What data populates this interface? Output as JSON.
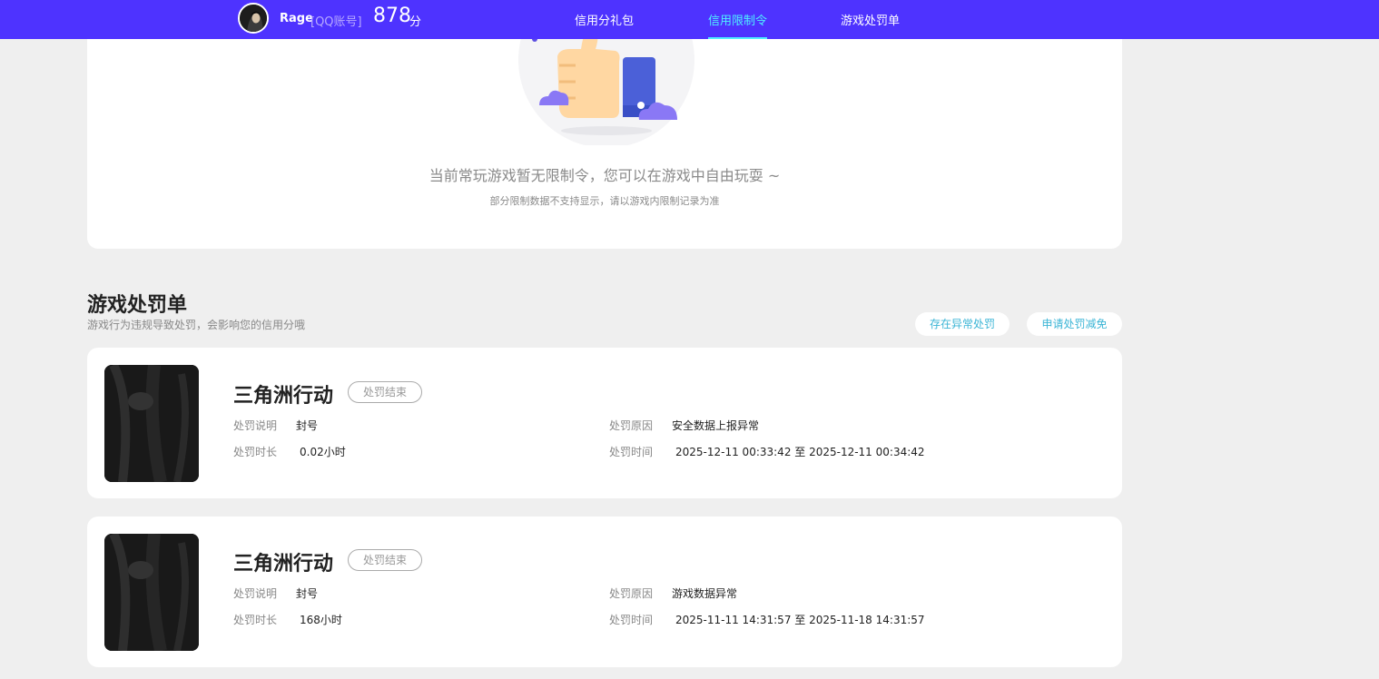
{
  "header": {
    "username": "Rage",
    "account_type": "[QQ账号]",
    "score": "878",
    "score_unit": "分",
    "nav": [
      {
        "label": "信用分礼包",
        "active": false
      },
      {
        "label": "信用限制令",
        "active": true
      },
      {
        "label": "游戏处罚单",
        "active": false
      }
    ]
  },
  "restriction": {
    "empty_title": "当前常玩游戏暂无限制令，您可以在游戏中自由玩耍 ~",
    "empty_subtitle": "部分限制数据不支持显示，请以游戏内限制记录为准"
  },
  "penalty_section": {
    "title": "游戏处罚单",
    "subtitle": "游戏行为违规导致处罚，会影响您的信用分哦",
    "report_button": "存在异常处罚",
    "appeal_button": "申请处罚减免",
    "labels": {
      "description": "处罚说明",
      "duration": "处罚时长",
      "reason": "处罚原因",
      "time": "处罚时间"
    },
    "items": [
      {
        "game": "三角洲行动",
        "status": "处罚结束",
        "description": "封号",
        "duration": "0.02小时",
        "reason": "安全数据上报异常",
        "time": "2025-12-11 00:33:42 至 2025-12-11 00:34:42"
      },
      {
        "game": "三角洲行动",
        "status": "处罚结束",
        "description": "封号",
        "duration": "168小时",
        "reason": "游戏数据异常",
        "time": "2025-11-11 14:31:57 至 2025-11-18 14:31:57"
      }
    ]
  },
  "colors": {
    "header_bg": "#4e33ff",
    "nav_active": "#4ff0ff",
    "page_bg": "#efefef",
    "pill_text": "#3bb5d6"
  }
}
